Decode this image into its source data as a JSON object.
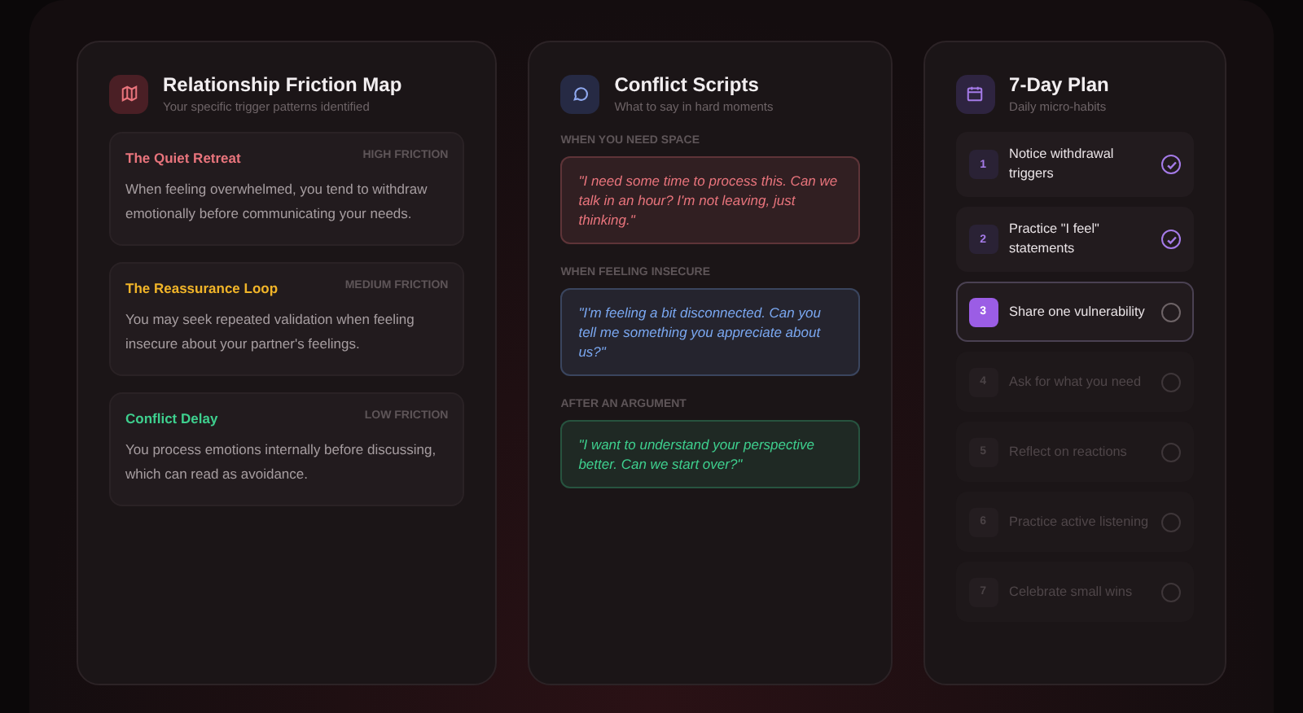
{
  "friction_map": {
    "title": "Relationship Friction Map",
    "subtitle": "Your specific trigger patterns identified",
    "patterns": [
      {
        "name": "The Quiet Retreat",
        "level_label": "HIGH FRICTION",
        "color": "#e8747c",
        "description": "When feeling overwhelmed, you tend to withdraw emotionally before communicating your needs."
      },
      {
        "name": "The Reassurance Loop",
        "level_label": "MEDIUM FRICTION",
        "color": "#f0b429",
        "description": "You may seek repeated validation when feeling insecure about your partner's feelings."
      },
      {
        "name": "Conflict Delay",
        "level_label": "LOW FRICTION",
        "color": "#3ecf8e",
        "description": "You process emotions internally before discussing, which can read as avoidance."
      }
    ]
  },
  "scripts": {
    "title": "Conflict Scripts",
    "subtitle": "What to say in hard moments",
    "items": [
      {
        "label": "WHEN YOU NEED SPACE",
        "color": "#e8747c",
        "text": "\"I need some time to process this. Can we talk in an hour? I'm not leaving, just thinking.\""
      },
      {
        "label": "WHEN FEELING INSECURE",
        "color": "#7aa7f0",
        "text": "\"I'm feeling a bit disconnected. Can you tell me something you appreciate about us?\""
      },
      {
        "label": "AFTER AN ARGUMENT",
        "color": "#3ecf8e",
        "text": "\"I want to understand your perspective better. Can we start over?\""
      }
    ]
  },
  "plan": {
    "title": "7-Day Plan",
    "subtitle": "Daily micro-habits",
    "days": [
      {
        "number": "1",
        "label": "Notice withdrawal triggers",
        "checked": true,
        "selected": false,
        "disabled": false
      },
      {
        "number": "2",
        "label": "Practice \"I feel\" statements",
        "checked": true,
        "selected": false,
        "disabled": false
      },
      {
        "number": "3",
        "label": "Share one vulnerability",
        "checked": false,
        "selected": true,
        "disabled": false
      },
      {
        "number": "4",
        "label": "Ask for what you need",
        "checked": false,
        "selected": false,
        "disabled": true
      },
      {
        "number": "5",
        "label": "Reflect on reactions",
        "checked": false,
        "selected": false,
        "disabled": true
      },
      {
        "number": "6",
        "label": "Practice active listening",
        "checked": false,
        "selected": false,
        "disabled": true
      },
      {
        "number": "7",
        "label": "Celebrate small wins",
        "checked": false,
        "selected": false,
        "disabled": true
      }
    ]
  }
}
